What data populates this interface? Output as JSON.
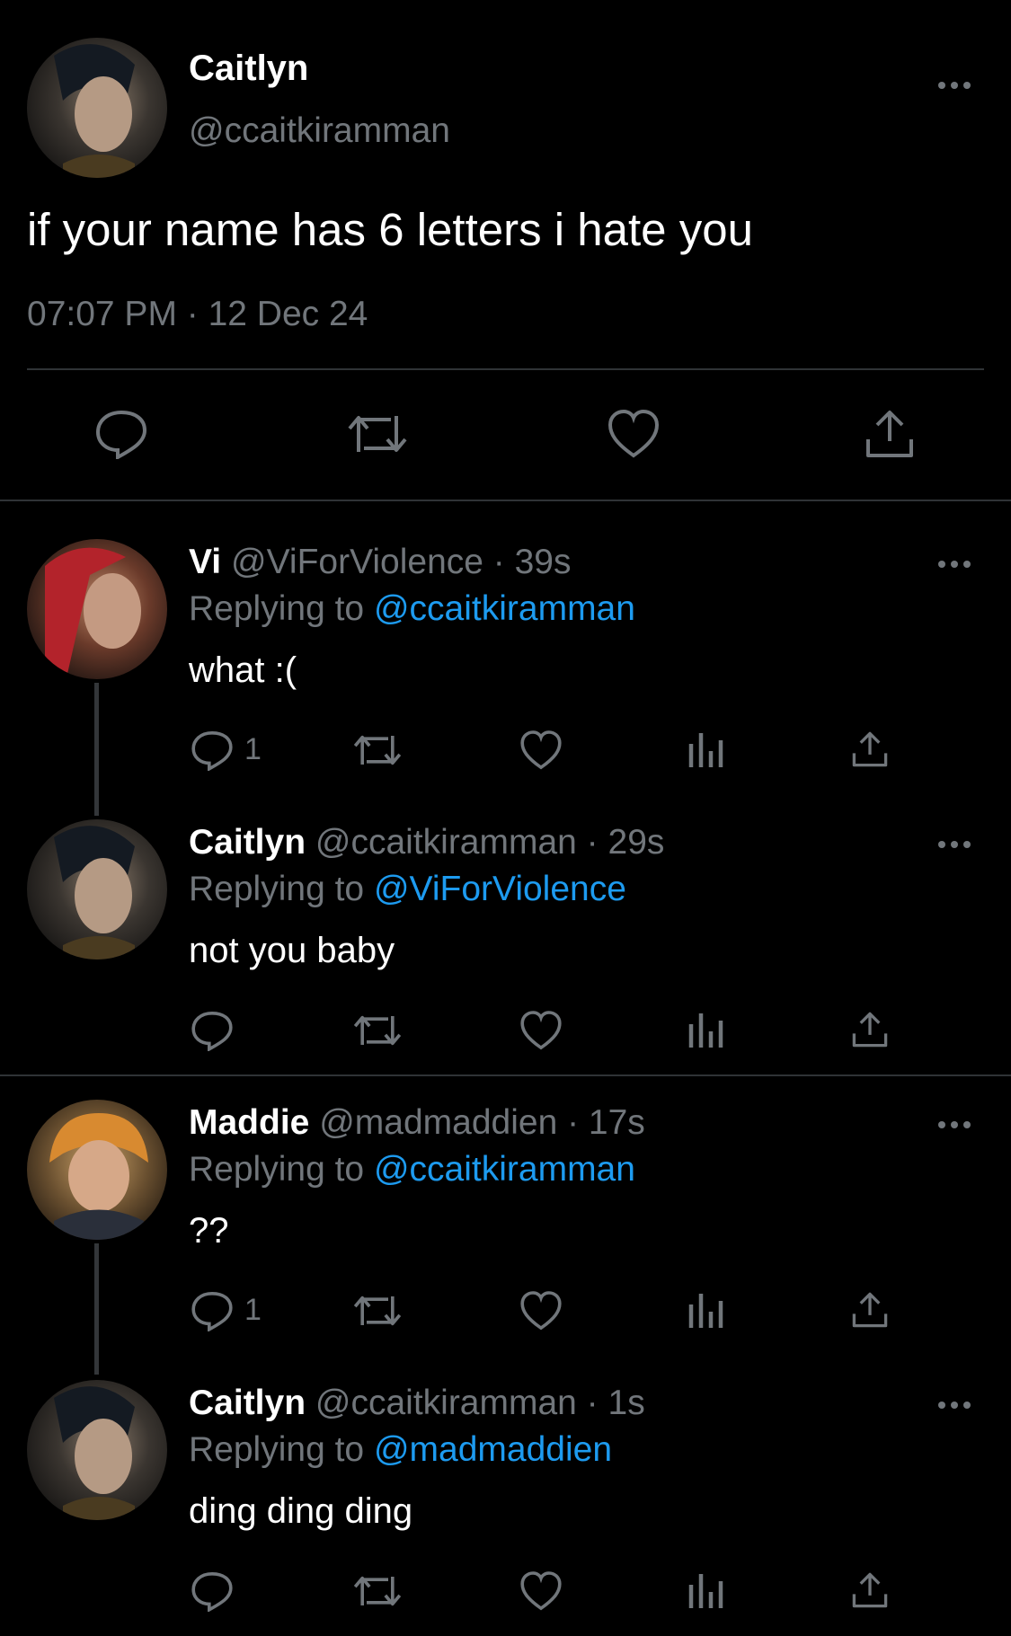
{
  "main_tweet": {
    "display_name": "Caitlyn",
    "handle": "@ccaitkiramman",
    "text": "if your name has 6 letters i hate you",
    "timestamp": "07:07 PM · 12 Dec 24"
  },
  "replies": [
    {
      "display_name": "Vi",
      "handle_time": "@ViForViolence · 39s",
      "replying_label": "Replying to ",
      "replying_to": "@ccaitkiramman",
      "text": "what :(",
      "reply_count": "1"
    },
    {
      "display_name": "Caitlyn",
      "handle_time": "@ccaitkiramman · 29s",
      "replying_label": "Replying to ",
      "replying_to": "@ViForViolence",
      "text": "not you baby",
      "reply_count": ""
    },
    {
      "display_name": "Maddie",
      "handle_time": "@madmaddien · 17s",
      "replying_label": "Replying to ",
      "replying_to": "@ccaitkiramman",
      "text": "??",
      "reply_count": "1"
    },
    {
      "display_name": "Caitlyn",
      "handle_time": "@ccaitkiramman · 1s",
      "replying_label": "Replying to ",
      "replying_to": "@madmaddien",
      "text": "ding ding ding",
      "reply_count": ""
    }
  ],
  "colors": {
    "background": "#000000",
    "muted": "#71767b",
    "link": "#1d9bf0",
    "divider": "#2f3336"
  },
  "icons": [
    "reply-icon",
    "retweet-icon",
    "like-icon",
    "share-icon",
    "views-icon",
    "more-icon"
  ]
}
